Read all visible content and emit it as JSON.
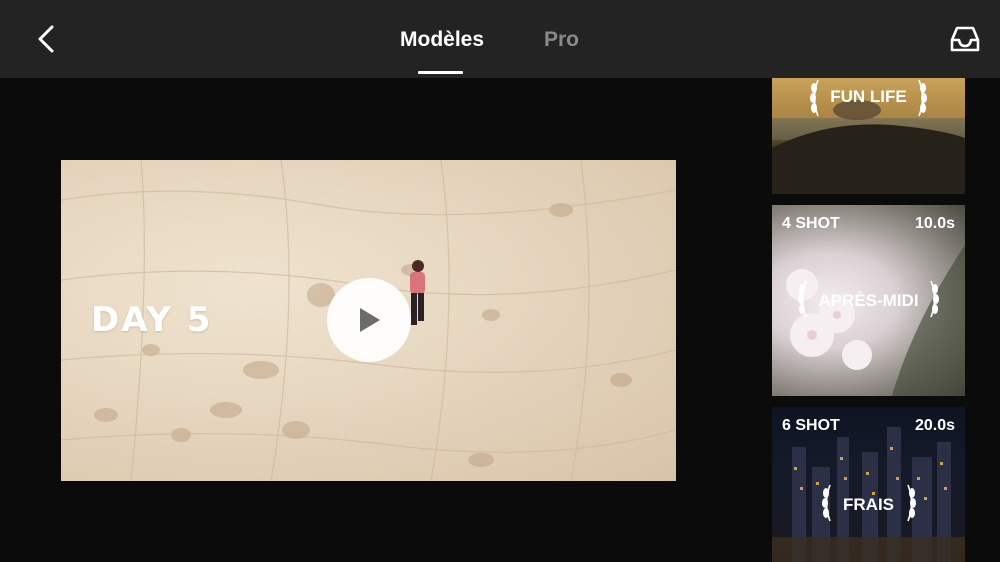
{
  "header": {
    "tabs": [
      {
        "label": "Modèles",
        "active": true
      },
      {
        "label": "Pro",
        "active": false
      }
    ],
    "back_icon": "chevron-left-icon",
    "library_icon": "tray-icon"
  },
  "preview": {
    "overlay_text": "DAY 5",
    "play_icon": "play-icon"
  },
  "templates": [
    {
      "shots": "",
      "duration": "",
      "name": "FUN LIFE"
    },
    {
      "shots": "4 SHOT",
      "duration": "10.0s",
      "name": "APRÈS-MIDI"
    },
    {
      "shots": "6 SHOT",
      "duration": "20.0s",
      "name": "FRAIS"
    }
  ],
  "colors": {
    "topbar": "#232323",
    "background": "#0b0b0b",
    "active_tab": "#ffffff",
    "inactive_tab": "#8a8a8a"
  }
}
